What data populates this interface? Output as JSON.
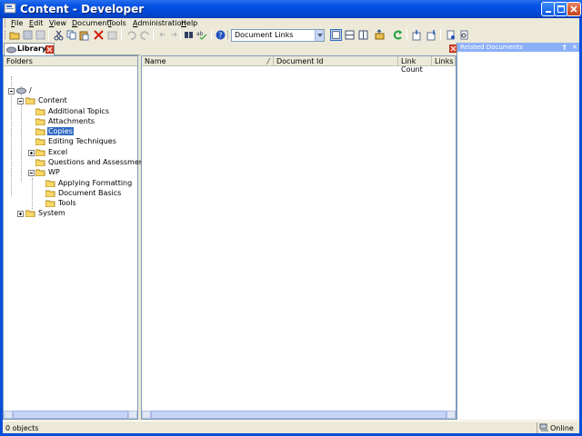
{
  "window": {
    "title": "Content - Developer"
  },
  "menu": [
    {
      "label": "File",
      "u": "F",
      "rest": "ile"
    },
    {
      "label": "Edit",
      "u": "E",
      "rest": "dit"
    },
    {
      "label": "View",
      "u": "V",
      "rest": "iew"
    },
    {
      "label": "Document",
      "u": "D",
      "rest": "ocument"
    },
    {
      "label": "Tools",
      "u": "T",
      "rest": "ools"
    },
    {
      "label": "Administration",
      "u": "A",
      "rest": "dministration"
    },
    {
      "label": "Help",
      "u": "H",
      "rest": "elp"
    }
  ],
  "toolbar": {
    "view_select": "Document Links"
  },
  "library": {
    "tab_label": "Library",
    "pane_header": "Folders",
    "tree": [
      {
        "label": "/"
      },
      {
        "label": "Content"
      },
      {
        "label": "Additional Topics"
      },
      {
        "label": "Attachments"
      },
      {
        "label": "Copies"
      },
      {
        "label": "Editing Techniques"
      },
      {
        "label": "Excel"
      },
      {
        "label": "Questions and Assessments"
      },
      {
        "label": "WP"
      },
      {
        "label": "Applying Formatting"
      },
      {
        "label": "Document Basics"
      },
      {
        "label": "Tools"
      },
      {
        "label": "System"
      }
    ]
  },
  "documents": {
    "columns": [
      "Name",
      "Document Id",
      "Link Count",
      "Links To"
    ]
  },
  "related": {
    "title": "Related Documents",
    "pin": "†",
    "close": "✕"
  },
  "status": {
    "left": "0 objects",
    "right": "Online"
  },
  "colors": {
    "title_bar": "#0554e3",
    "selection": "#316ac5",
    "related_header": "#8cb0f8"
  }
}
